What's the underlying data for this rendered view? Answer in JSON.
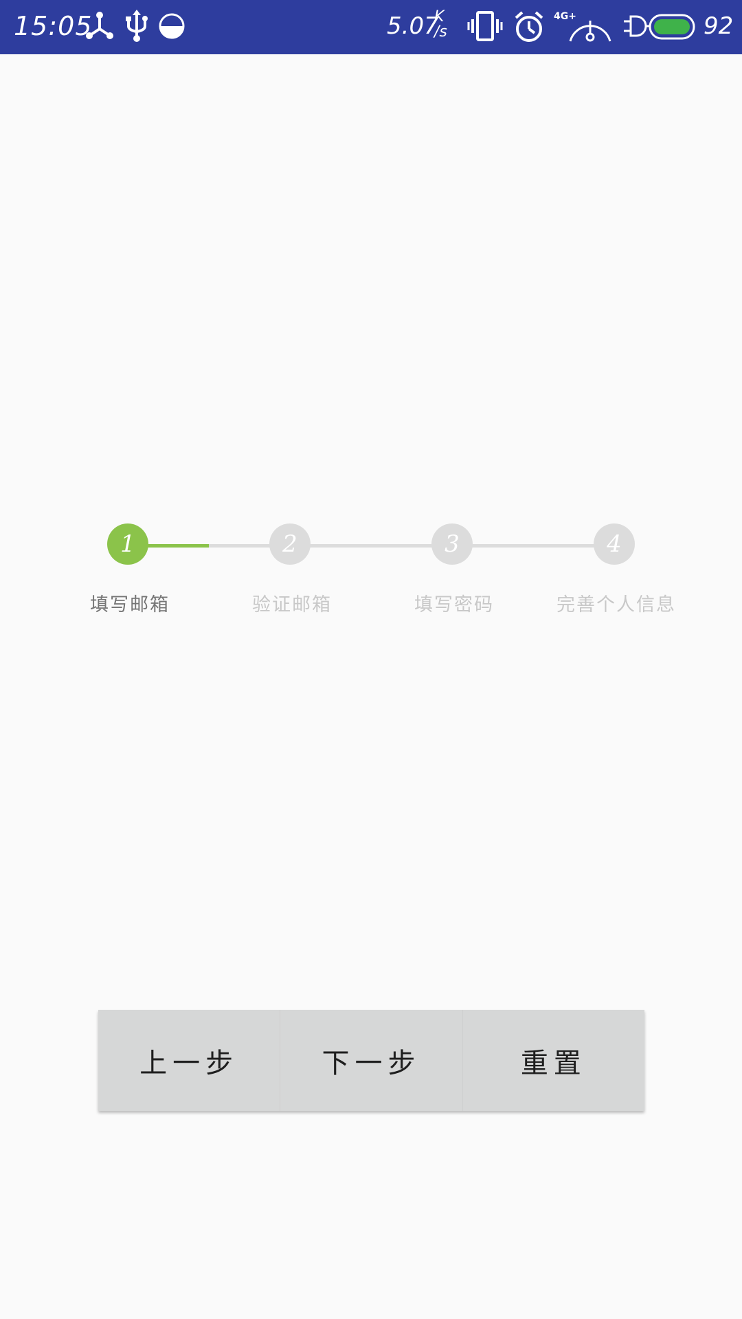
{
  "status_bar": {
    "time": "15:05",
    "net_speed": "5.07",
    "net_speed_unit_top": "K",
    "net_speed_unit_bottom": "/s",
    "signal_type": "4G+",
    "battery_level": "92",
    "bg_color": "#2e3d9e",
    "icons": [
      "share-icon",
      "usb-icon",
      "data-saver-icon",
      "vibrate-icon",
      "alarm-icon",
      "signal-icon",
      "charging-icon",
      "battery-icon"
    ]
  },
  "stepper": {
    "active_color": "#8bc34a",
    "inactive_color": "#dcdcdc",
    "steps": [
      {
        "number": "1",
        "label": "填写邮箱",
        "active": true
      },
      {
        "number": "2",
        "label": "验证邮箱",
        "active": false
      },
      {
        "number": "3",
        "label": "填写密码",
        "active": false
      },
      {
        "number": "4",
        "label": "完善个人信息",
        "active": false
      }
    ]
  },
  "buttons": {
    "prev_label": "上一步",
    "next_label": "下一步",
    "reset_label": "重置"
  }
}
